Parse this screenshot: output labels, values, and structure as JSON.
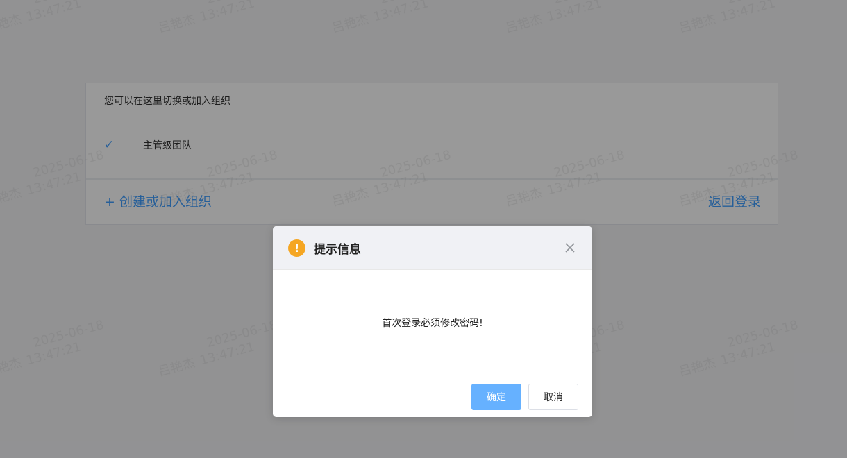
{
  "org_panel": {
    "header_text": "您可以在这里切换或加入组织",
    "items": [
      {
        "check": "✓",
        "name": "主管级团队"
      }
    ],
    "create_join_link": "+ 创建或加入组织",
    "back_to_login_link": "返回登录"
  },
  "dialog": {
    "icon": "warning-icon",
    "icon_glyph": "!",
    "title": "提示信息",
    "message": "首次登录必须修改密码!",
    "confirm_label": "确定",
    "cancel_label": "取消"
  },
  "watermark": {
    "name": "吕艳杰",
    "date": "2025-06-18",
    "time": "13:47:21"
  },
  "colors": {
    "accent": "#409eff",
    "primary_button": "#66b1ff",
    "warning": "#f5a623"
  }
}
